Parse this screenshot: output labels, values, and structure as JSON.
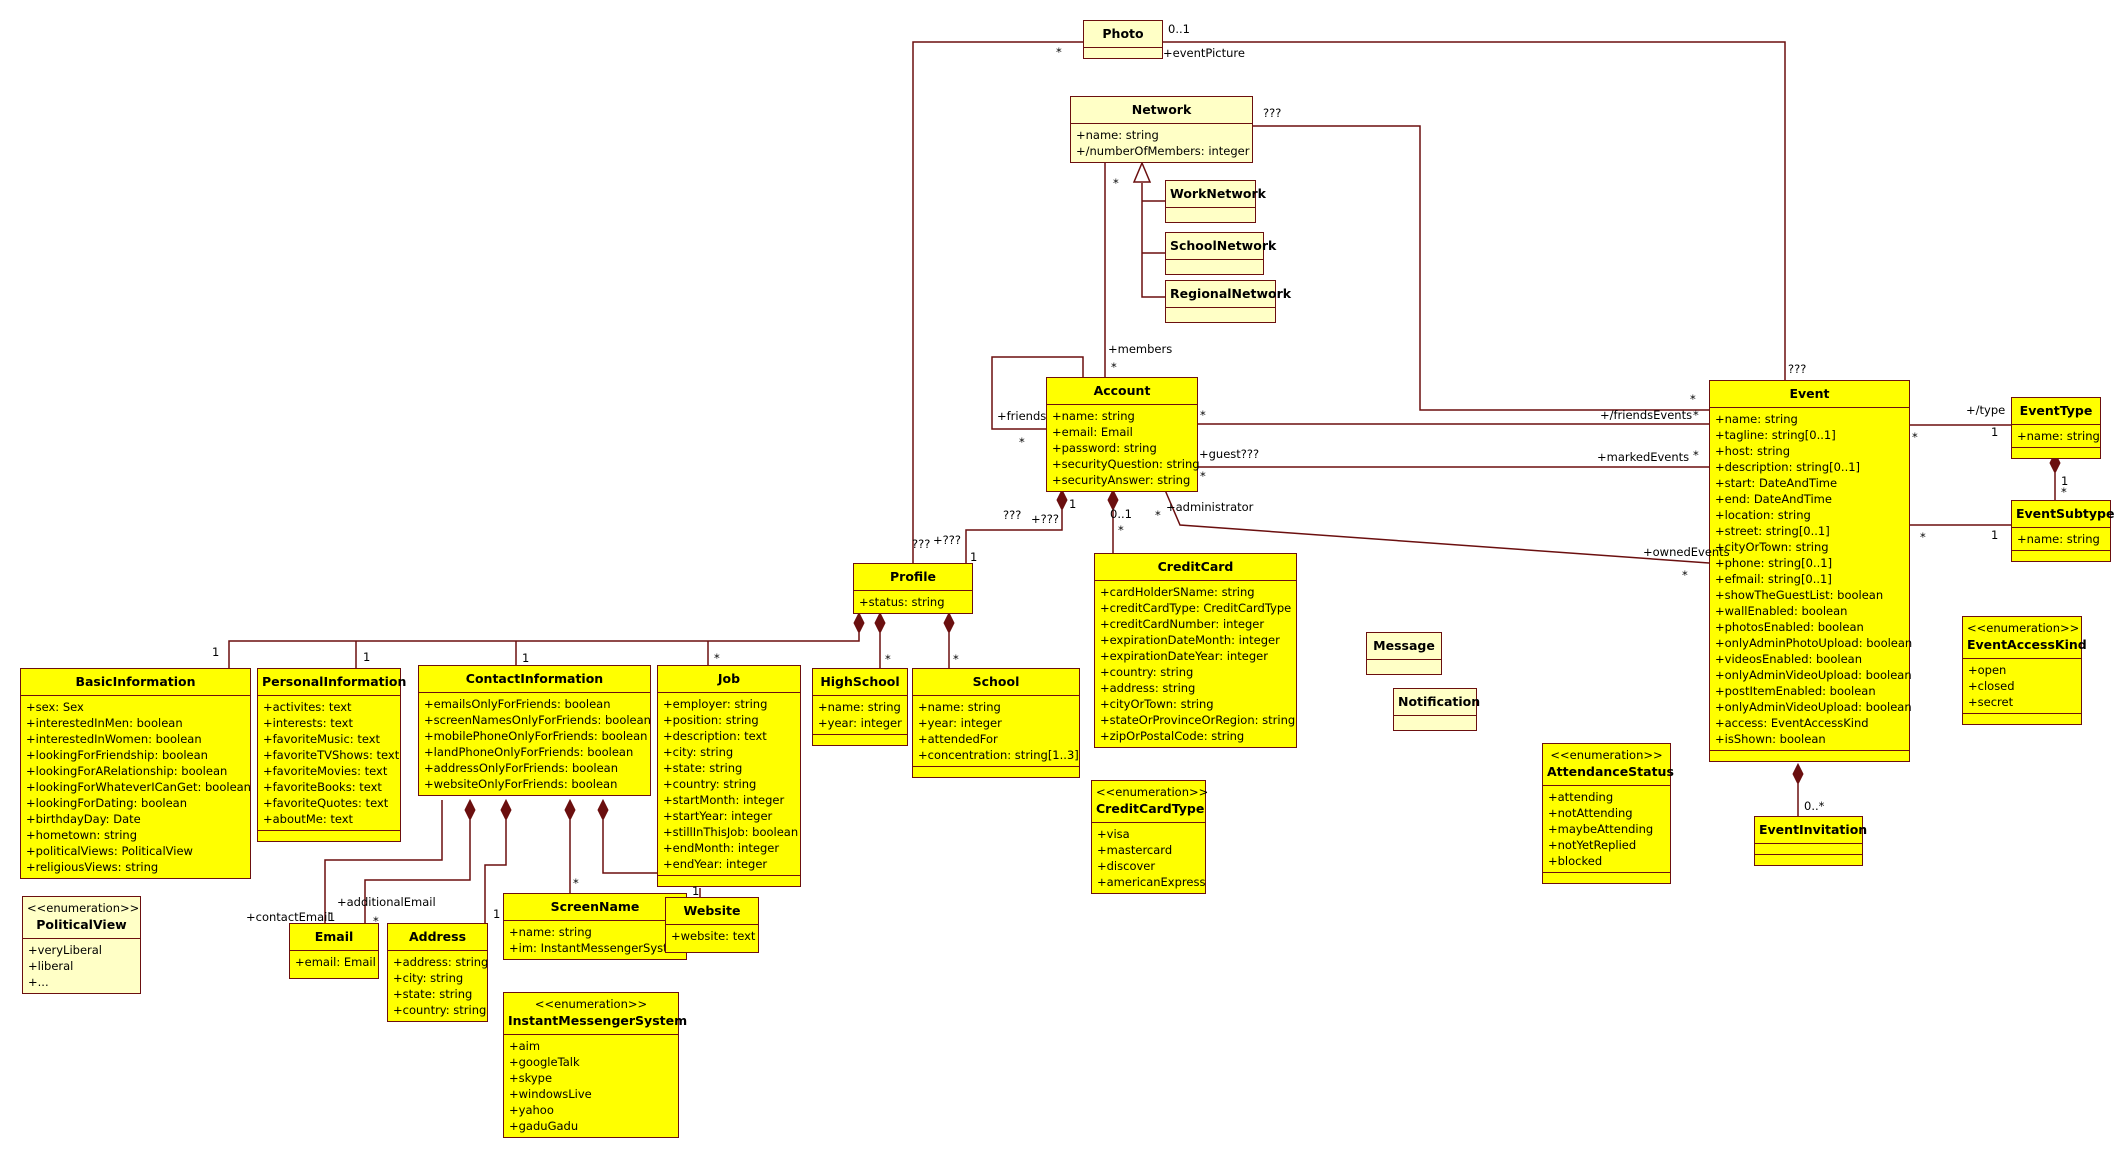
{
  "diagram": {
    "type": "UML class diagram",
    "colors": {
      "class_fill": "#ffff00",
      "pale_fill": "#ffffc6",
      "line": "#6b0f0f"
    },
    "classes": {
      "photo": {
        "name": "Photo",
        "attributes": []
      },
      "network": {
        "name": "Network",
        "attributes": [
          "+name: string",
          "+/numberOfMembers: integer"
        ]
      },
      "workNetwork": {
        "name": "WorkNetwork",
        "attributes": []
      },
      "schoolNetwork": {
        "name": "SchoolNetwork",
        "attributes": []
      },
      "regionalNetwork": {
        "name": "RegionalNetwork",
        "attributes": []
      },
      "account": {
        "name": "Account",
        "attributes": [
          "+name: string",
          "+email: Email",
          "+password: string",
          "+securityQuestion: string",
          "+securityAnswer: string"
        ]
      },
      "profile": {
        "name": "Profile",
        "attributes": [
          "+status: string"
        ]
      },
      "basicInformation": {
        "name": "BasicInformation",
        "attributes": [
          "+sex: Sex",
          "+interestedInMen: boolean",
          "+interestedInWomen: boolean",
          "+lookingForFriendship: boolean",
          "+lookingForARelationship: boolean",
          "+lookingForWhateverICanGet: boolean",
          "+lookingForDating: boolean",
          "+birthdayDay: Date",
          "+hometown: string",
          "+politicalViews: PoliticalView",
          "+religiousViews: string"
        ]
      },
      "personalInformation": {
        "name": "PersonalInformation",
        "attributes": [
          "+activites: text",
          "+interests: text",
          "+favoriteMusic: text",
          "+favoriteTVShows: text",
          "+favoriteMovies: text",
          "+favoriteBooks: text",
          "+favoriteQuotes: text",
          "+aboutMe: text"
        ]
      },
      "contactInformation": {
        "name": "ContactInformation",
        "attributes": [
          "+emailsOnlyForFriends: boolean",
          "+screenNamesOnlyForFriends: boolean",
          "+mobilePhoneOnlyForFriends: boolean",
          "+landPhoneOnlyForFriends: boolean",
          "+addressOnlyForFriends: boolean",
          "+websiteOnlyForFriends: boolean"
        ]
      },
      "job": {
        "name": "Job",
        "attributes": [
          "+employer: string",
          "+position: string",
          "+description: text",
          "+city: string",
          "+state: string",
          "+country: string",
          "+startMonth: integer",
          "+startYear: integer",
          "+stillInThisJob: boolean",
          "+endMonth: integer",
          "+endYear: integer"
        ]
      },
      "highSchool": {
        "name": "HighSchool",
        "attributes": [
          "+name: string",
          "+year: integer"
        ]
      },
      "school": {
        "name": "School",
        "attributes": [
          "+name: string",
          "+year: integer",
          "+attendedFor",
          "+concentration: string[1..3]"
        ]
      },
      "creditCard": {
        "name": "CreditCard",
        "attributes": [
          "+cardHolderSName: string",
          "+creditCardType: CreditCardType",
          "+creditCardNumber: integer",
          "+expirationDateMonth: integer",
          "+expirationDateYear: integer",
          "+country: string",
          "+address: string",
          "+cityOrTown: string",
          "+stateOrProvinceOrRegion: string",
          "+zipOrPostalCode: string"
        ]
      },
      "creditCardType": {
        "stereotype": "<<enumeration>>",
        "name": "CreditCardType",
        "attributes": [
          "+visa",
          "+mastercard",
          "+discover",
          "+americanExpress"
        ]
      },
      "email": {
        "name": "Email",
        "attributes": [
          "+email: Email"
        ]
      },
      "address": {
        "name": "Address",
        "attributes": [
          "+address: string",
          "+city: string",
          "+state: string",
          "+country: string"
        ]
      },
      "screenName": {
        "name": "ScreenName",
        "attributes": [
          "+name: string",
          "+im: InstantMessengerSyste"
        ]
      },
      "website": {
        "name": "Website",
        "attributes": [
          "+website: text"
        ]
      },
      "politicalView": {
        "stereotype": "<<enumeration>>",
        "name": "PoliticalView",
        "attributes": [
          "+veryLiberal",
          "+liberal",
          "+..."
        ]
      },
      "instantMessengerSystem": {
        "stereotype": "<<enumeration>>",
        "name": "InstantMessengerSystem",
        "attributes": [
          "+aim",
          "+googleTalk",
          "+skype",
          "+windowsLive",
          "+yahoo",
          "+gaduGadu"
        ]
      },
      "message": {
        "name": "Message",
        "attributes": []
      },
      "notification": {
        "name": "Notification",
        "attributes": []
      },
      "attendanceStatus": {
        "stereotype": "<<enumeration>>",
        "name": "AttendanceStatus",
        "attributes": [
          "+attending",
          "+notAttending",
          "+maybeAttending",
          "+notYetReplied",
          "+blocked"
        ]
      },
      "event": {
        "name": "Event",
        "attributes": [
          "+name: string",
          "+tagline: string[0..1]",
          "+host: string",
          "+description: string[0..1]",
          "+start: DateAndTime",
          "+end: DateAndTime",
          "+location: string",
          "+street: string[0..1]",
          "+cityOrTown: string",
          "+phone: string[0..1]",
          "+efmail: string[0..1]",
          "+showTheGuestList: boolean",
          "+wallEnabled: boolean",
          "+photosEnabled: boolean",
          "+onlyAdminPhotoUpload: boolean",
          "+videosEnabled: boolean",
          "+onlyAdminVideoUpload: boolean",
          "+postItemEnabled: boolean",
          "+onlyAdminVideoUpload: boolean",
          "+access: EventAccessKind",
          "+isShown: boolean"
        ]
      },
      "eventType": {
        "name": "EventType",
        "attributes": [
          "+name: string"
        ]
      },
      "eventSubtype": {
        "name": "EventSubtype",
        "attributes": [
          "+name: string"
        ]
      },
      "eventAccessKind": {
        "stereotype": "<<enumeration>>",
        "name": "EventAccessKind",
        "attributes": [
          "+open",
          "+closed",
          "+secret"
        ]
      },
      "eventInvitation": {
        "name": "EventInvitation",
        "attributes": []
      }
    },
    "labels": {
      "photo_star": "*",
      "photo_01": "0..1",
      "event_picture": "+eventPicture",
      "network_qqq": "???",
      "network_star": "*",
      "members": "+members",
      "members_star": "*",
      "event_qqq": "???",
      "friends": "+friends",
      "friends_star": "*",
      "acc_star1": "*",
      "friends_events": "+/friendsEvents",
      "friends_events_star": "*",
      "friends_events_star2": "*",
      "guest": "+guest???",
      "acc_star2": "*",
      "marked_events": "+markedEvents",
      "marked_star": "*",
      "administrator": "+administrator",
      "admin_star": "*",
      "owned_events": "+ownedEvents",
      "owned_star": "*",
      "acc_comp_1": "1",
      "acc_qqq": "???",
      "acc_plus_qqq": "+???",
      "cc_01": "0..1",
      "cc_star": "*",
      "profile_qqq": "???",
      "profile_plus_qqq": "+???",
      "profile_1": "1",
      "basic_1": "1",
      "personal_1": "1",
      "contact_1": "1",
      "job_star": "*",
      "highschool_star": "*",
      "school_star": "*",
      "contact_email": "+contactEmail",
      "contact_email_1": "1",
      "additional_email": "+additionalEmail",
      "additional_star": "*",
      "address_1": "1",
      "screenname_star": "*",
      "website_1": "1",
      "type": "+/type",
      "type_1": "1",
      "type_star": "*",
      "subtype_1": "1",
      "subtype_star": "*",
      "sub_comp_1": "1",
      "sub_comp_star": "*",
      "invitation_mult": "0..*"
    }
  }
}
